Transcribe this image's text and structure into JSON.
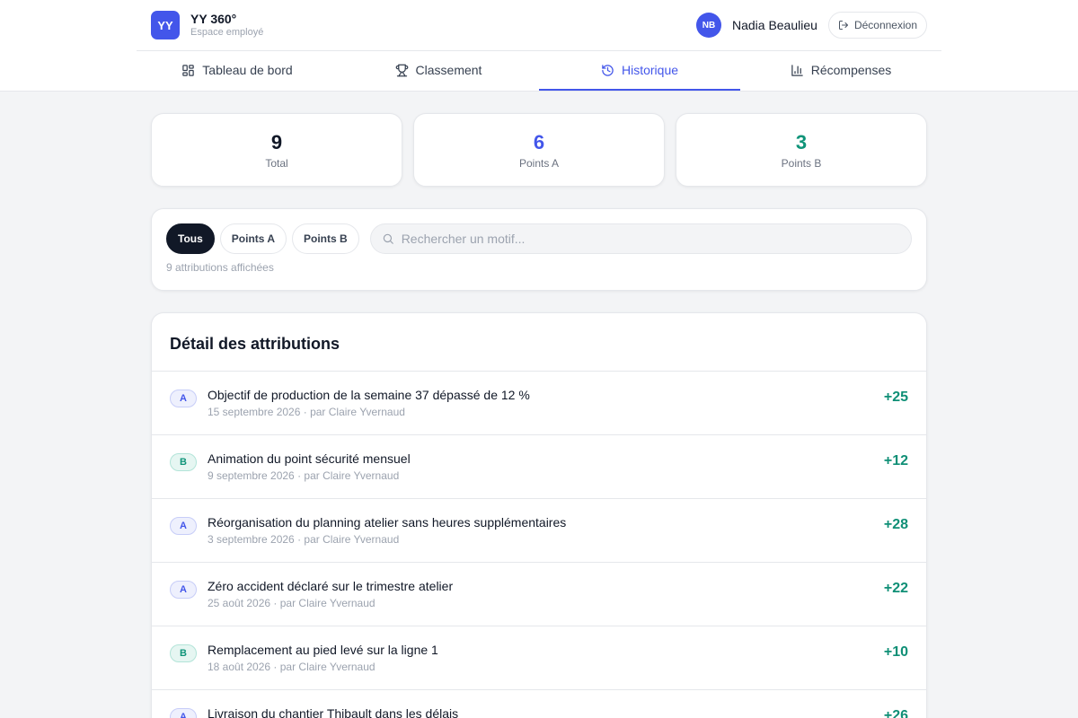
{
  "brand": {
    "logo": "YY",
    "name": "YY 360°",
    "subtitle": "Espace employé"
  },
  "user": {
    "initials": "NB",
    "name": "Nadia Beaulieu",
    "logout_label": "Déconnexion"
  },
  "nav": [
    {
      "label": "Tableau de bord",
      "icon": "dashboard-icon"
    },
    {
      "label": "Classement",
      "icon": "trophy-icon"
    },
    {
      "label": "Historique",
      "icon": "history-icon",
      "active": true
    },
    {
      "label": "Récompenses",
      "icon": "bar-chart-icon"
    }
  ],
  "stats": [
    {
      "value": "9",
      "label": "Total",
      "color": "#111827"
    },
    {
      "value": "6",
      "label": "Points A",
      "color": "#4356ea"
    },
    {
      "value": "3",
      "label": "Points B",
      "color": "#0f9479"
    }
  ],
  "filters": {
    "chips": [
      "Tous",
      "Points A",
      "Points B"
    ],
    "active": "Tous",
    "search_placeholder": "Rechercher un motif...",
    "search_value": "",
    "count_text": "9 attributions affichées"
  },
  "list": {
    "title": "Détail des attributions",
    "items": [
      {
        "type": "A",
        "title": "Objectif de production de la semaine 37 dépassé de 12 %",
        "meta": "15 septembre 2026 · par Claire Yvernaud",
        "points": "+25"
      },
      {
        "type": "B",
        "title": "Animation du point sécurité mensuel",
        "meta": "9 septembre 2026 · par Claire Yvernaud",
        "points": "+12"
      },
      {
        "type": "A",
        "title": "Réorganisation du planning atelier sans heures supplémentaires",
        "meta": "3 septembre 2026 · par Claire Yvernaud",
        "points": "+28"
      },
      {
        "type": "A",
        "title": "Zéro accident déclaré sur le trimestre atelier",
        "meta": "25 août 2026 · par Claire Yvernaud",
        "points": "+22"
      },
      {
        "type": "B",
        "title": "Remplacement au pied levé sur la ligne 1",
        "meta": "18 août 2026 · par Claire Yvernaud",
        "points": "+10"
      },
      {
        "type": "A",
        "title": "Livraison du chantier Thibault dans les délais",
        "meta": "",
        "points": "+26"
      }
    ]
  }
}
